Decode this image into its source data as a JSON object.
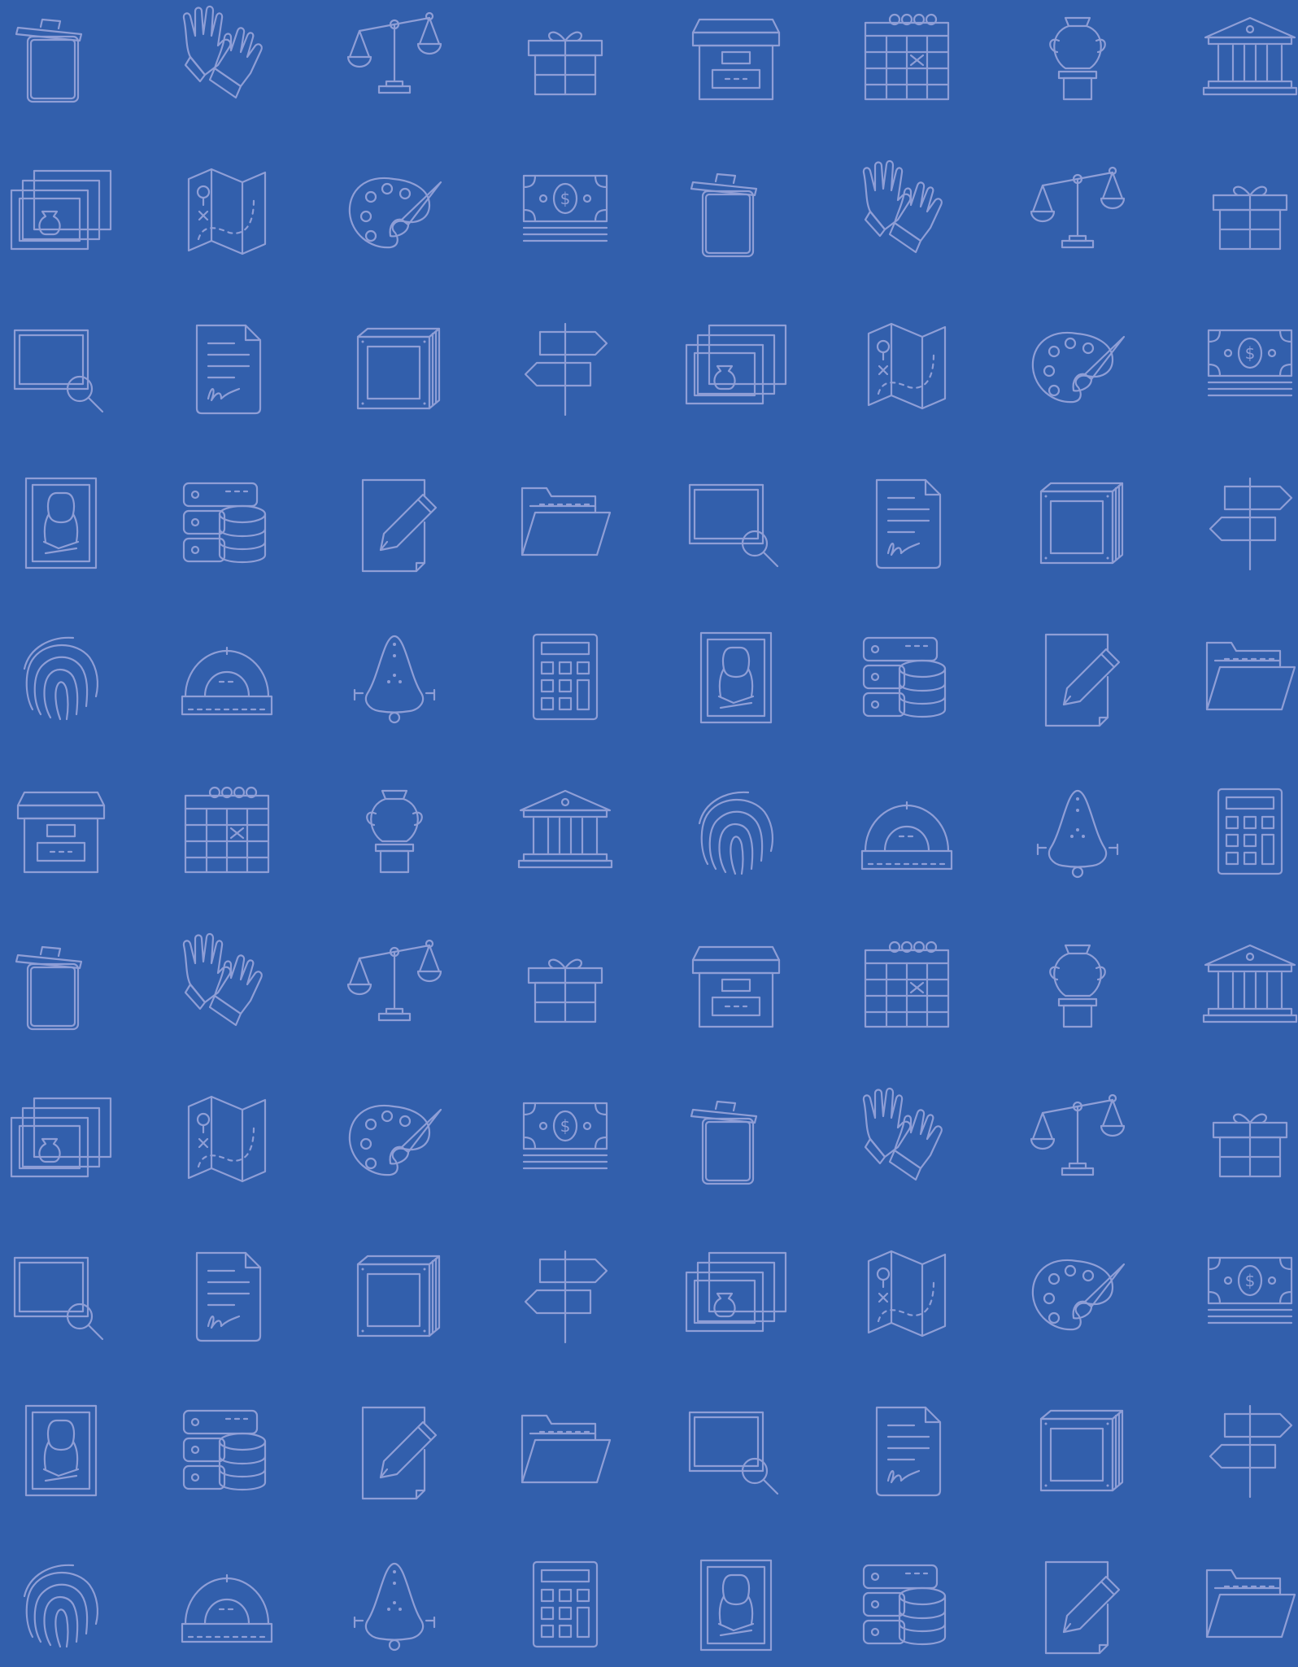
{
  "colors": {
    "background": "#325fac",
    "icon": "#8f9ed6"
  },
  "row_pattern_a": [
    "trash-can-icon",
    "gloves-icon",
    "scales-icon",
    "gift-box-icon",
    "archive-box-icon",
    "calendar-icon",
    "vase-on-pedestal-icon",
    "museum-building-icon"
  ],
  "row_pattern_b": [
    "framed-pictures-icon",
    "treasure-map-icon",
    "paint-palette-icon",
    "money-stack-icon",
    "trash-can-icon",
    "gloves-icon",
    "scales-icon",
    "gift-box-icon"
  ],
  "row_pattern_c": [
    "frame-search-icon",
    "signed-document-icon",
    "wooden-crate-icon",
    "direction-signpost-icon",
    "framed-pictures-icon",
    "treasure-map-icon",
    "paint-palette-icon",
    "money-stack-icon"
  ],
  "row_pattern_d": [
    "mona-lisa-painting-icon",
    "database-server-icon",
    "document-edit-icon",
    "open-folder-icon",
    "frame-search-icon",
    "signed-document-icon",
    "wooden-crate-icon",
    "direction-signpost-icon"
  ],
  "row_pattern_e": [
    "fingerprint-icon",
    "protractor-icon",
    "urinal-fountain-icon",
    "calculator-icon",
    "mona-lisa-painting-icon",
    "database-server-icon",
    "document-edit-icon",
    "open-folder-icon"
  ],
  "row_pattern_f": [
    "archive-box-icon",
    "calendar-icon",
    "vase-on-pedestal-icon",
    "museum-building-icon",
    "fingerprint-icon",
    "protractor-icon",
    "urinal-fountain-icon",
    "calculator-icon"
  ],
  "grid": {
    "columns": 8,
    "rows": 11,
    "row_sequence": [
      "a",
      "b",
      "c",
      "d",
      "e",
      "f",
      "a",
      "b",
      "c",
      "d",
      "e"
    ]
  }
}
